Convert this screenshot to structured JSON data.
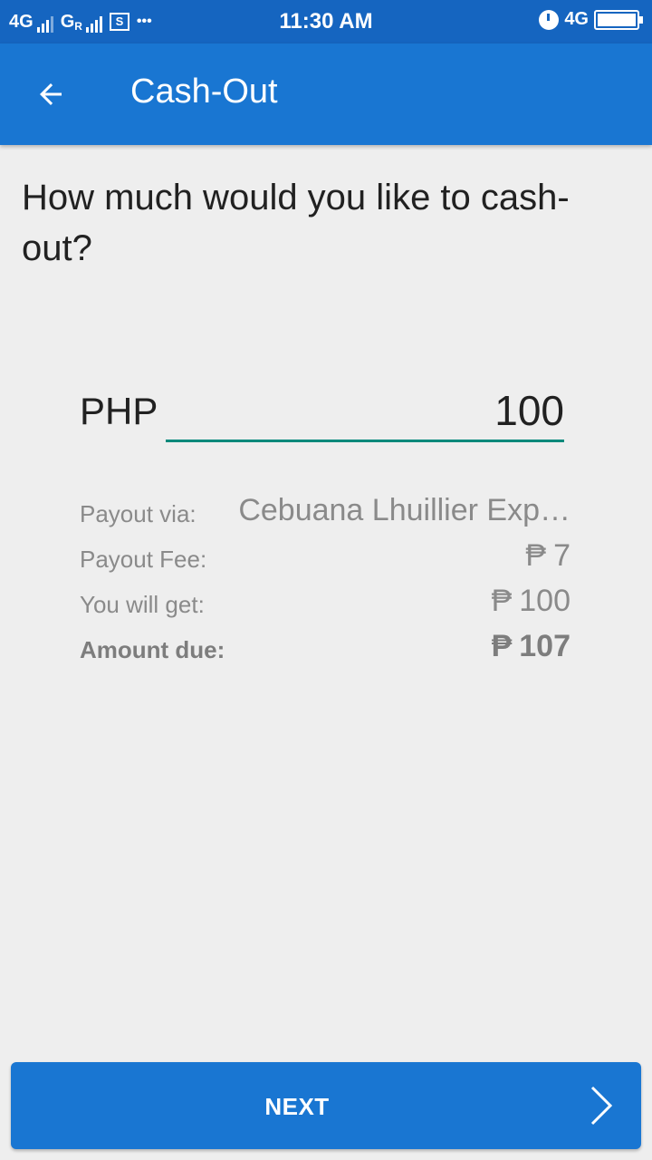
{
  "status_bar": {
    "network1": "4G",
    "network2": "G",
    "network2_badge": "R",
    "sim_box": "S",
    "more": "•••",
    "time": "11:30 AM",
    "network_right": "4G",
    "icons": [
      "signal-icon",
      "storage-icon",
      "alarm-icon",
      "battery-icon"
    ]
  },
  "app_bar": {
    "title": "Cash-Out",
    "back_icon": "arrow-left-icon",
    "color": "#1976d2"
  },
  "question": "How much would you like to cash-out?",
  "amount": {
    "currency": "PHP",
    "value": "100",
    "underline_color": "#00897b"
  },
  "details": [
    {
      "label": "Payout via:",
      "value": "Cebuana Lhuillier Exp…",
      "currency": ""
    },
    {
      "label": "Payout Fee:",
      "value": "7",
      "currency": "₱"
    },
    {
      "label": "You will get:",
      "value": "100",
      "currency": "₱"
    },
    {
      "label": "Amount due:",
      "value": "107",
      "currency": "₱"
    }
  ],
  "next_button": {
    "label": "NEXT",
    "icon": "chevron-right-icon"
  }
}
